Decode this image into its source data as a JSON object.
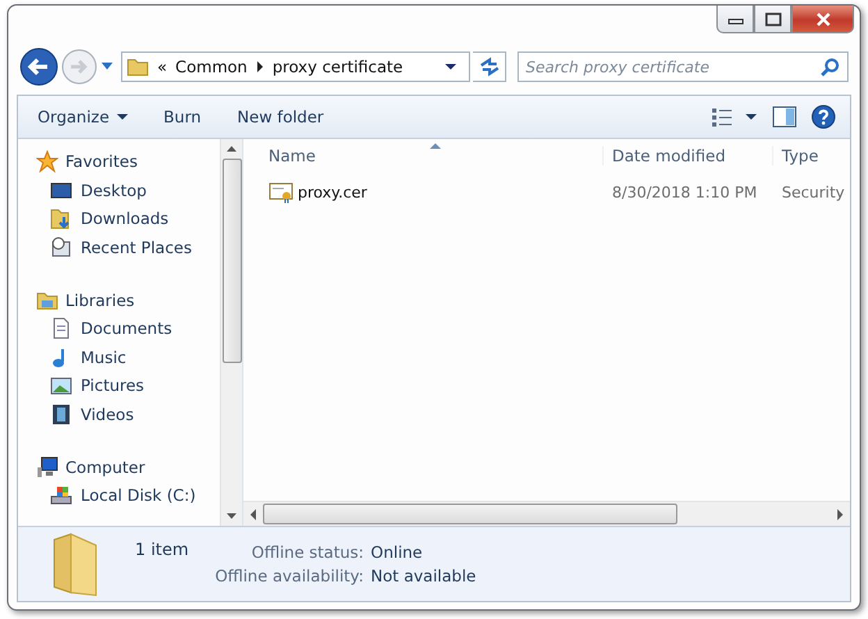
{
  "address": {
    "parts": [
      "«",
      "Common",
      "proxy certificate"
    ]
  },
  "search": {
    "placeholder": "Search proxy certificate"
  },
  "toolbar": {
    "buttons": [
      {
        "label": "Organize",
        "kind": "menu"
      },
      {
        "label": "Burn",
        "kind": "plain"
      },
      {
        "label": "New folder",
        "kind": "plain"
      }
    ]
  },
  "sidebar": {
    "groups": [
      {
        "label": "Favorites",
        "kind": "star",
        "children": [
          {
            "label": "Desktop",
            "kind": "desktop"
          },
          {
            "label": "Downloads",
            "kind": "downloads"
          },
          {
            "label": "Recent Places",
            "kind": "recent"
          }
        ]
      },
      {
        "label": "Libraries",
        "kind": "libraries",
        "children": [
          {
            "label": "Documents",
            "kind": "documents"
          },
          {
            "label": "Music",
            "kind": "music"
          },
          {
            "label": "Pictures",
            "kind": "pictures"
          },
          {
            "label": "Videos",
            "kind": "videos"
          }
        ]
      },
      {
        "label": "Computer",
        "kind": "computer",
        "children": [
          {
            "label": "Local Disk (C:)",
            "kind": "disk"
          }
        ]
      }
    ]
  },
  "table": {
    "columns": [
      "Name",
      "Date modified",
      "Type"
    ],
    "rows": [
      {
        "name": "proxy.cer",
        "date": "8/30/2018 1:10 PM",
        "type": "Security"
      }
    ]
  },
  "details": {
    "count": "1 item",
    "fields": [
      {
        "label": "Offline status:",
        "value": "Online"
      },
      {
        "label": "Offline availability:",
        "value": "Not available"
      }
    ]
  }
}
